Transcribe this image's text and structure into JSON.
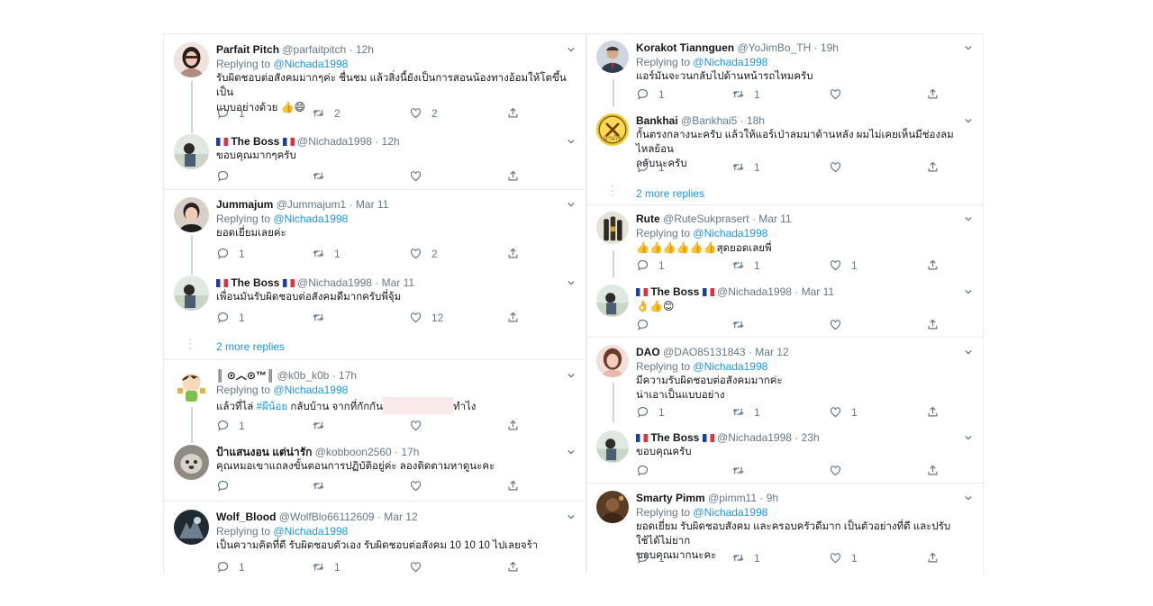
{
  "left": {
    "g1": {
      "t1": {
        "name": "Parfait Pitch",
        "handle": "@parfaitpitch",
        "time": "12h",
        "replying": "Replying to",
        "reply_to": "@Nichada1998",
        "text1": "รับผิดชอบต่อสังคมมากๆค่ะ ชื่นชม แล้วสิ่งนี้ยังเป็นการสอนน้องทางอ้อมให้โตขึ้นเป็น",
        "text2": "แบบอย่างด้วย",
        "emoji": "👍😄",
        "replies": "1",
        "retweets": "2",
        "likes": "2"
      },
      "t2": {
        "name": "The Boss",
        "handle": "@Nichada1998",
        "time": "12h",
        "text": "ขอบคุณมากๆครับ"
      }
    },
    "g2": {
      "t1": {
        "name": "Jummajum",
        "handle": "@Jummajum1",
        "time": "Mar 11",
        "replying": "Replying to",
        "reply_to": "@Nichada1998",
        "text": "ยอดเยี่ยมเลยค่ะ",
        "replies": "1",
        "retweets": "1",
        "likes": "2"
      },
      "t2": {
        "name": "The Boss",
        "handle": "@Nichada1998",
        "time": "Mar 11",
        "text": "เพื่อนมันรับผิดชอบต่อสังคมดีมากครับพี่จุ้ม",
        "replies": "1",
        "likes": "12"
      },
      "more": "2 more replies"
    },
    "g3": {
      "t1": {
        "name": "║ ⊙︿⊙™║",
        "handle": "@k0b_k0b",
        "time": "17h",
        "replying": "Replying to",
        "reply_to": "@Nichada1998",
        "text_a": "แล้วที่ไล่ ",
        "tag": "#ผีน้อย",
        "text_b": "  กลับบ้าน จากที่กักกัน",
        "text_c": "ทำไง",
        "replies": "1"
      },
      "t2": {
        "name": "ป้าแสนงอน แต่น่ารัก",
        "handle": "@kobboon2560",
        "time": "17h",
        "text": "คุณหมอเขาแถลงขั้นตอนการปฏิบัติอยู่ค่ะ ลองติดตามหาดูนะคะ"
      }
    },
    "g4": {
      "t1": {
        "name": "Wolf_Blood",
        "handle": "@WolfBlo66112609",
        "time": "Mar 12",
        "replying": "Replying to",
        "reply_to": "@Nichada1998",
        "text": "เป็นความคิดที่ดี รับผิดชอบตัวเอง รับผิดชอบต่อสังคม 10 10 10 ไปเลยจร้า",
        "replies": "1",
        "retweets": "1"
      }
    }
  },
  "right": {
    "g1": {
      "t1": {
        "name": "Korakot Tiannguen",
        "handle": "@YoJimBo_TH",
        "time": "19h",
        "replying": "Replying to",
        "reply_to": "@Nichada1998",
        "text": "แอร์มันจะวนกลับไปด้านหน้ารถไหมครับ",
        "replies": "1",
        "retweets": "1"
      },
      "t2": {
        "name": "Bankhai",
        "handle": "@Bankhai5",
        "time": "18h",
        "text1": "กั้นตรงกลางนะครับ แล้วให้แอร์เป่าลมมาด้านหลัง ผมไม่เคยเห็นมีช่องลมไหลย้อน",
        "text2": "กลับนะครับ",
        "replies": "1",
        "retweets": "1",
        "avatar_text": "บ้านไข่"
      },
      "more": "2 more replies"
    },
    "g2": {
      "t1": {
        "name": "Rute",
        "handle": "@RuteSukprasert",
        "time": "Mar 11",
        "replying": "Replying to",
        "reply_to": "@Nichada1998",
        "emoji": "👍👍👍👍👍👍",
        "text": "สุดยอดเลยพี่",
        "replies": "1",
        "retweets": "1",
        "likes": "1"
      },
      "t2": {
        "name": "The Boss",
        "handle": "@Nichada1998",
        "time": "Mar 11",
        "emoji": "👌👍😊"
      }
    },
    "g3": {
      "t1": {
        "name": "DAO",
        "handle": "@DAO85131843",
        "time": "Mar 12",
        "replying": "Replying to",
        "reply_to": "@Nichada1998",
        "text1": "มีความรับผิดชอบต่อสังคมมากค่ะ",
        "text2": "น่าเอาเป็นแบบอย่าง",
        "replies": "1",
        "retweets": "1",
        "likes": "1"
      },
      "t2": {
        "name": "The Boss",
        "handle": "@Nichada1998",
        "time": "23h",
        "text": "ขอบคุณครับ"
      }
    },
    "g4": {
      "t1": {
        "name": "Smarty Pimm",
        "handle": "@pimm11",
        "time": "9h",
        "replying": "Replying to",
        "reply_to": "@Nichada1998",
        "text1": "ยอดเยี่ยม รับผิดชอบสังคม และครอบครัวดีมาก เป็นตัวอย่างที่ดี และปรับใช้ได้ไม่ยาก",
        "text2": "ขอบคุณมากนะคะ",
        "replies": "1",
        "retweets": "1",
        "likes": "1"
      }
    }
  },
  "colors": {
    "link": "#1b95e0",
    "muted": "#657786",
    "border": "#e6ecf0",
    "thread": "#ccd6dd"
  },
  "icons": [
    "reply-icon",
    "retweet-icon",
    "like-icon",
    "share-icon",
    "caret-down-icon",
    "flag-icon"
  ]
}
